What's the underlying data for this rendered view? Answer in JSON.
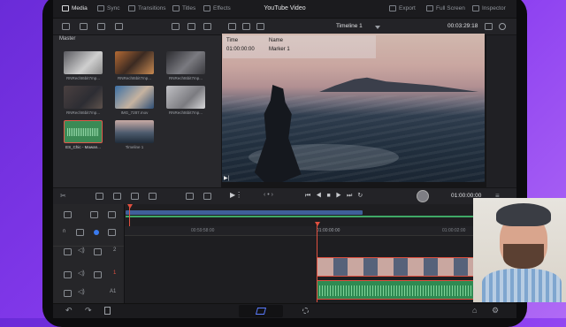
{
  "app": {
    "project_title": "YouTube Video",
    "tabs": [
      {
        "label": "Media",
        "active": true
      },
      {
        "label": "Sync",
        "active": false
      },
      {
        "label": "Transitions",
        "active": false
      },
      {
        "label": "Titles",
        "active": false
      },
      {
        "label": "Effects",
        "active": false
      }
    ],
    "right_actions": [
      {
        "label": "Export"
      },
      {
        "label": "Full Screen"
      },
      {
        "label": "Inspector"
      }
    ]
  },
  "viewer_bar": {
    "timeline_name": "Timeline 1",
    "timecode": "00:03:29:18"
  },
  "media_pool": {
    "title": "Master",
    "clips": [
      {
        "name": "RNRecht6bit7mp..."
      },
      {
        "name": "RNRecht6bit7mp..."
      },
      {
        "name": "RNRecht6bit7mp..."
      },
      {
        "name": "RNRecht6bit7mp..."
      },
      {
        "name": "IMG_7287.mov"
      },
      {
        "name": "RNRecht6bit7mp..."
      },
      {
        "name": "ES_Chic - Mawan..."
      },
      {
        "name": "Timeline 1"
      }
    ]
  },
  "marker": {
    "time_label": "Time",
    "time_value": "01:00:00:00",
    "name_label": "Name",
    "name_value": "Marker 1"
  },
  "transport": {
    "timecode": "01:00:00:00"
  },
  "timeline": {
    "ruler": [
      "00:59:58:00",
      "01:00:00:00",
      "01:00:02:00"
    ],
    "tracks": [
      {
        "label": "2"
      },
      {
        "label": "1"
      },
      {
        "label": "A1"
      }
    ]
  },
  "colors": {
    "accent_red": "#e0503f",
    "video_clip_blue": "#3f5f9a",
    "audio_green": "#3fa866",
    "background_purple": "#7b35e6"
  }
}
